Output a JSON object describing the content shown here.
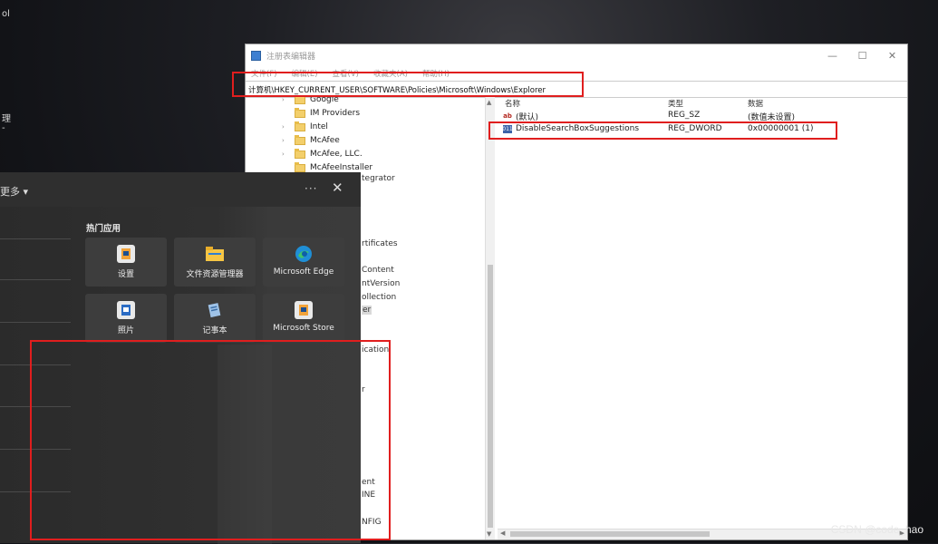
{
  "desktop": {
    "frag1": "ol",
    "frag2": "理",
    "frag3": "-"
  },
  "regedit": {
    "title": "注册表编辑器",
    "window_controls": {
      "minimize": "—",
      "maximize": "☐",
      "close": "✕"
    },
    "menu": [
      "文件(F)",
      "编辑(E)",
      "查看(V)",
      "收藏夹(A)",
      "帮助(H)"
    ],
    "address": "计算机\\HKEY_CURRENT_USER\\SOFTWARE\\Policies\\Microsoft\\Windows\\Explorer",
    "tree": [
      {
        "label": "Google",
        "expandable": true
      },
      {
        "label": "IM Providers",
        "expandable": false
      },
      {
        "label": "Intel",
        "expandable": true
      },
      {
        "label": "McAfee",
        "expandable": true
      },
      {
        "label": "McAfee, LLC.",
        "expandable": true
      },
      {
        "label": "McAfeeInstaller",
        "expandable": false
      }
    ],
    "tree_fragments": [
      "tegrator",
      "rtificates",
      "Content",
      "ntVersion",
      "ollection",
      "er",
      "ication",
      "r",
      "ent",
      "INE",
      "NFIG"
    ],
    "columns": {
      "name": "名称",
      "type": "类型",
      "data": "数据"
    },
    "values": [
      {
        "icon": "ab",
        "name": "(默认)",
        "type": "REG_SZ",
        "data": "(数值未设置)"
      },
      {
        "icon": "binary",
        "name": "DisableSearchBoxSuggestions",
        "type": "REG_DWORD",
        "data": "0x00000001 (1)"
      }
    ]
  },
  "start_panel": {
    "filter_label": "更多 ▾",
    "more_label": "···",
    "close_label": "✕",
    "popular_heading": "热门应用",
    "apps": [
      {
        "label": "设置",
        "icon": "settings-icon"
      },
      {
        "label": "文件资源管理器",
        "icon": "file-explorer-icon"
      },
      {
        "label": "Microsoft Edge",
        "icon": "edge-icon"
      },
      {
        "label": "照片",
        "icon": "photos-icon"
      },
      {
        "label": "记事本",
        "icon": "notepad-icon"
      },
      {
        "label": "Microsoft Store",
        "icon": "store-icon"
      }
    ]
  },
  "watermark": "CSDN @code_hao",
  "colors": {
    "highlight": "#e01e1e",
    "panel_bg": "#2f2f2f",
    "tile_bg": "#3d3d3d"
  }
}
